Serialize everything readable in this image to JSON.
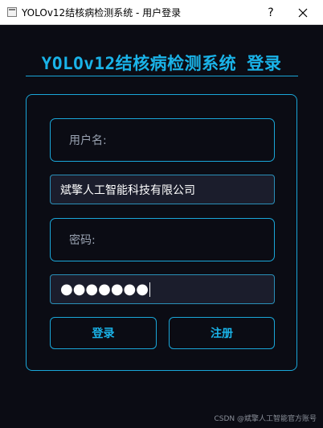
{
  "window": {
    "title": "YOLOv12结核病检测系统 - 用户登录",
    "help_label": "?"
  },
  "header": {
    "title": "YOLOv12结核病检测系统 登录"
  },
  "form": {
    "username_label": "用户名:",
    "username_value": "斌擎人工智能科技有限公司",
    "password_label": "密码:",
    "password_masked": "●●●●●●●"
  },
  "buttons": {
    "login": "登录",
    "register": "注册"
  },
  "watermark": "CSDN @斌擎人工智能官方账号",
  "colors": {
    "accent": "#1ab3e8",
    "background": "#0b0c14",
    "input_bg": "#1b1d2c"
  }
}
